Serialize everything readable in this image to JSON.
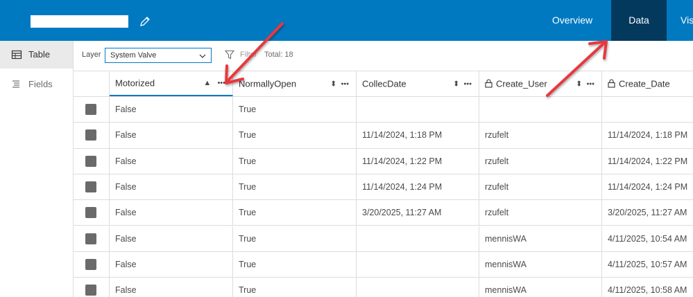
{
  "header": {
    "nav": [
      {
        "label": "Overview"
      },
      {
        "label": "Data"
      },
      {
        "label": "Vis"
      }
    ]
  },
  "sidebar": {
    "items": [
      {
        "label": "Table",
        "icon": "table-icon"
      },
      {
        "label": "Fields",
        "icon": "fields-icon"
      }
    ]
  },
  "toolbar": {
    "layer_label": "Layer",
    "layer_value": "System Valve",
    "filter_label": "Filter",
    "total_label": "Total: 18"
  },
  "table": {
    "columns": [
      "Motorized",
      "NormallyOpen",
      "CollecDate",
      "Create_User",
      "Create_Date"
    ],
    "rows": [
      [
        "False",
        "True",
        "",
        "",
        ""
      ],
      [
        "False",
        "True",
        "11/14/2024, 1:18 PM",
        "rzufelt",
        "11/14/2024, 1:18 PM"
      ],
      [
        "False",
        "True",
        "11/14/2024, 1:22 PM",
        "rzufelt",
        "11/14/2024, 1:22 PM"
      ],
      [
        "False",
        "True",
        "11/14/2024, 1:24 PM",
        "rzufelt",
        "11/14/2024, 1:24 PM"
      ],
      [
        "False",
        "True",
        "3/20/2025, 11:27 AM",
        "rzufelt",
        "3/20/2025, 11:27 AM"
      ],
      [
        "False",
        "True",
        "",
        "mennisWA",
        "4/11/2025, 10:54 AM"
      ],
      [
        "False",
        "True",
        "",
        "mennisWA",
        "4/11/2025, 10:57 AM"
      ],
      [
        "False",
        "True",
        "",
        "mennisWA",
        "4/11/2025, 10:58 AM"
      ]
    ]
  },
  "colors": {
    "header_bg": "#0079c1",
    "active_tab_bg": "#04395e",
    "annotation_arrow": "#e8383d"
  }
}
